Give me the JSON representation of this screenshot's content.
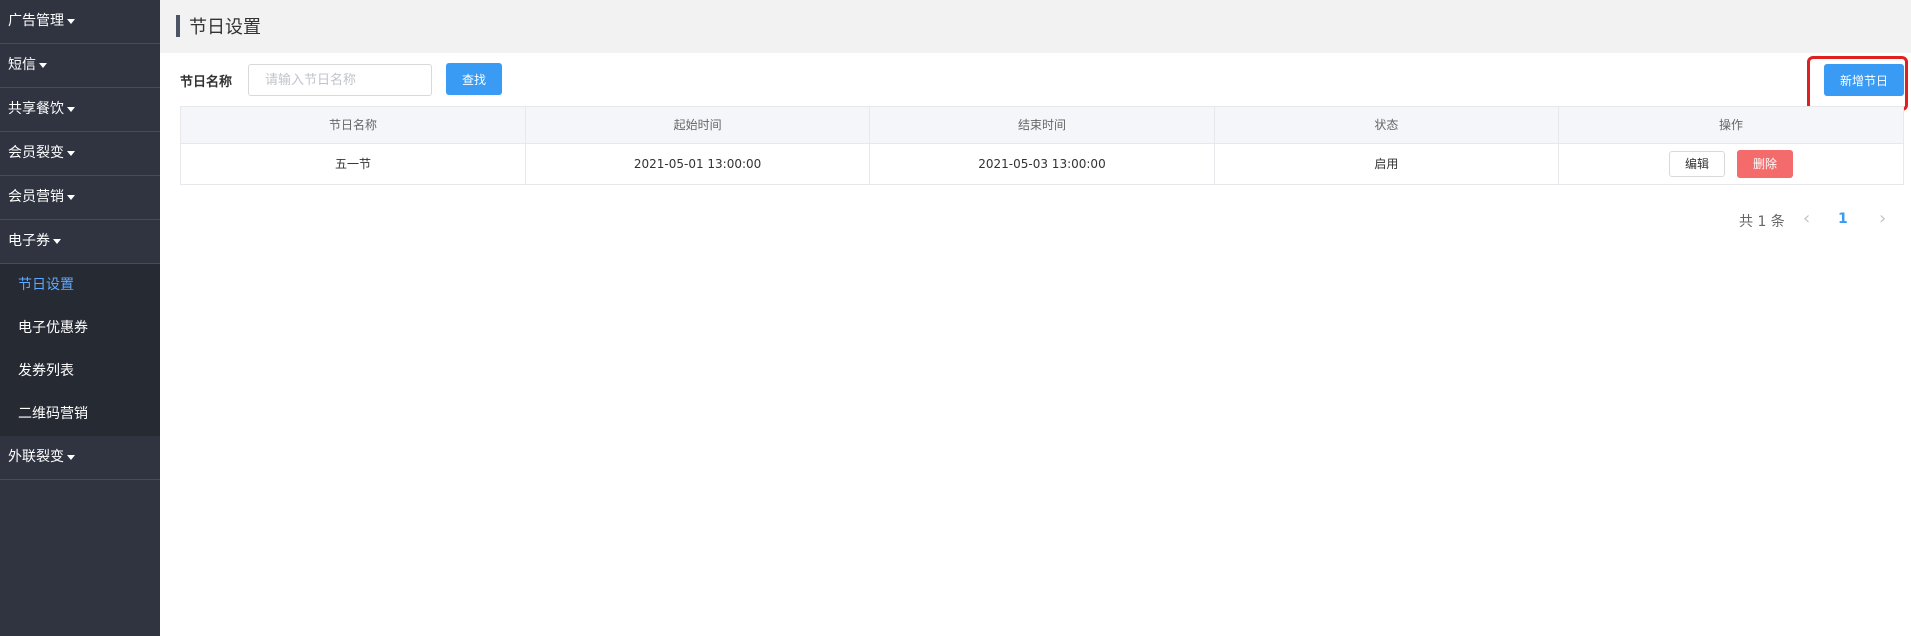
{
  "sidebar": {
    "groups": [
      {
        "label": "广告管理"
      },
      {
        "label": "短信"
      },
      {
        "label": "共享餐饮"
      },
      {
        "label": "会员裂变"
      },
      {
        "label": "会员营销"
      },
      {
        "label": "电子券",
        "expanded": true
      }
    ],
    "sub_items": [
      {
        "label": "节日设置",
        "active": true
      },
      {
        "label": "电子优惠券"
      },
      {
        "label": "发券列表"
      },
      {
        "label": "二维码营销"
      }
    ],
    "after_group": {
      "label": "外联裂变"
    },
    "active_color": "#5ea8ff"
  },
  "header": {
    "title": "节日设置"
  },
  "search": {
    "label": "节日名称",
    "placeholder": "请输入节日名称",
    "value": "",
    "button_label": "查找"
  },
  "toolbar": {
    "add_label": "新增节日"
  },
  "table": {
    "columns": [
      "节日名称",
      "起始时间",
      "结束时间",
      "状态",
      "操作"
    ],
    "rows": [
      {
        "name": "五一节",
        "start": "2021-05-01 13:00:00",
        "end": "2021-05-03 13:00:00",
        "status": "启用",
        "edit_label": "编辑",
        "delete_label": "删除"
      }
    ]
  },
  "pagination": {
    "total_text": "共 1 条",
    "current_page": "1",
    "prev_icon": "chevron-left-icon",
    "next_icon": "chevron-right-icon"
  },
  "colors": {
    "primary": "#3a9bf5",
    "danger": "#f36b6b",
    "sidebar_bg": "#2f3440",
    "highlight": "#e02020"
  }
}
